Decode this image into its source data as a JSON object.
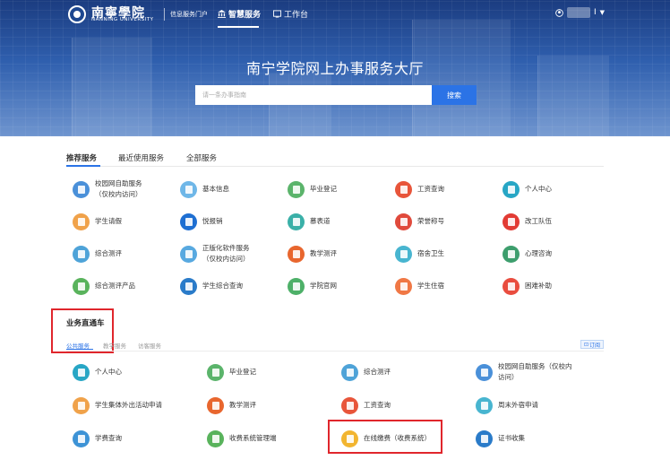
{
  "header": {
    "logo_cn": "南寧學院",
    "logo_en": "NANNING UNIVERSITY",
    "portal_label": "信息服务门户",
    "nav": [
      {
        "label": "智慧服务",
        "active": true
      },
      {
        "label": "工作台",
        "active": false
      }
    ],
    "user_name": "I"
  },
  "hero": {
    "title": "南宁学院网上办事服务大厅",
    "search_placeholder": "请一条办事指南",
    "search_button": "搜索"
  },
  "tabs": [
    {
      "label": "推荐服务",
      "active": true
    },
    {
      "label": "最近使用服务",
      "active": false
    },
    {
      "label": "全部服务",
      "active": false
    }
  ],
  "recommended": [
    {
      "label": "校园网自助服务\n（仅校内访问）",
      "color": "#4a90d9"
    },
    {
      "label": "基本信息",
      "color": "#6fb7e8"
    },
    {
      "label": "毕业登记",
      "color": "#5bb46b"
    },
    {
      "label": "工资查询",
      "color": "#e8553a"
    },
    {
      "label": "个人中心",
      "color": "#27a6c5"
    },
    {
      "label": "学生请假",
      "color": "#f0a24a"
    },
    {
      "label": "悦报销",
      "color": "#1e6fd2"
    },
    {
      "label": "慕表道",
      "color": "#3ab0a8"
    },
    {
      "label": "荣誉称号",
      "color": "#e04a3c"
    },
    {
      "label": "改工队伍",
      "color": "#e23b34"
    },
    {
      "label": "综合测评",
      "color": "#4ea3d8"
    },
    {
      "label": "正版化软件服务\n（仅校内访问）",
      "color": "#58a9e0"
    },
    {
      "label": "教学测评",
      "color": "#e8662e"
    },
    {
      "label": "宿舍卫生",
      "color": "#48b5d0"
    },
    {
      "label": "心理咨询",
      "color": "#3d9e6d"
    },
    {
      "label": "综合测评产品",
      "color": "#59b35c"
    },
    {
      "label": "学生综合查询",
      "color": "#2a7bc9"
    },
    {
      "label": "学院官网",
      "color": "#4db068"
    },
    {
      "label": "学生住宿",
      "color": "#f07845"
    },
    {
      "label": "困难补助",
      "color": "#e94d3f"
    }
  ],
  "direct": {
    "title": "业务直通车",
    "subtabs": [
      {
        "label": "公共服务",
        "active": true
      },
      {
        "label": "教学服务",
        "active": false
      },
      {
        "label": "访客服务",
        "active": false
      }
    ],
    "subscribe": "订阅",
    "items": [
      {
        "label": "个人中心",
        "color": "#27a6c5"
      },
      {
        "label": "毕业登记",
        "color": "#5bb46b"
      },
      {
        "label": "综合测评",
        "color": "#4ea3d8"
      },
      {
        "label": "校园网自助服务（仅校内\n访问）",
        "color": "#4a90d9"
      },
      {
        "label": "学生集体外出活动申请",
        "color": "#f0a24a"
      },
      {
        "label": "教学测评",
        "color": "#e8662e"
      },
      {
        "label": "工资查询",
        "color": "#e8553a"
      },
      {
        "label": "周末外宿申请",
        "color": "#48b5d0"
      },
      {
        "label": "学费查询",
        "color": "#3d93d6"
      },
      {
        "label": "收费系统管理端",
        "color": "#59b35c"
      },
      {
        "label": "在线缴费（收费系统）",
        "color": "#f2b530"
      },
      {
        "label": "证书收集",
        "color": "#2a7bc9"
      }
    ]
  }
}
